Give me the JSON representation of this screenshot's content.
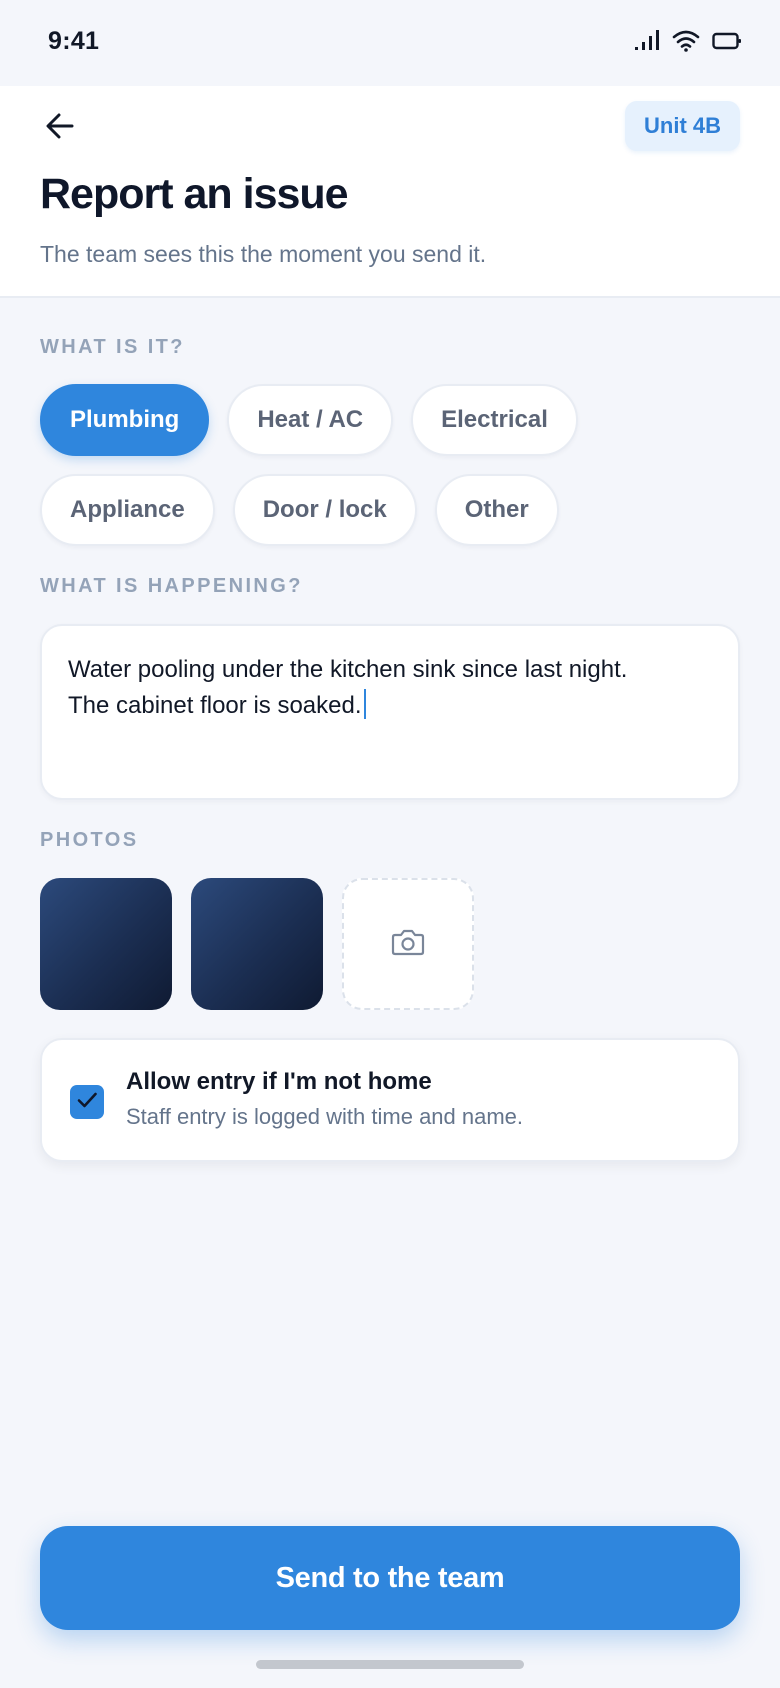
{
  "status_bar": {
    "time": "9:41"
  },
  "header": {
    "unit_badge": "Unit 4B",
    "title": "Report an issue",
    "subtitle": "The team sees this the moment you send it."
  },
  "category_section": {
    "label": "WHAT IS IT?",
    "selected": "Plumbing",
    "chips": [
      "Plumbing",
      "Heat / AC",
      "Electrical",
      "Appliance",
      "Door / lock",
      "Other"
    ]
  },
  "description_section": {
    "label": "WHAT IS HAPPENING?",
    "line1": "Water pooling under the kitchen sink since last night.",
    "line2": "The cabinet floor is soaked."
  },
  "photos_section": {
    "label": "PHOTOS",
    "photo_count": 2,
    "add_icon": "camera-icon"
  },
  "entry_permission": {
    "checked": true,
    "title": "Allow entry if I'm not home",
    "description": "Staff entry is logged with time and name."
  },
  "send_button": {
    "label": "Send to the team"
  },
  "colors": {
    "accent": "#2f86dd",
    "background": "#f4f6fb",
    "muted_text": "#64748b",
    "section_label": "#94a3b8",
    "photo_dark": "#1b2e52"
  }
}
